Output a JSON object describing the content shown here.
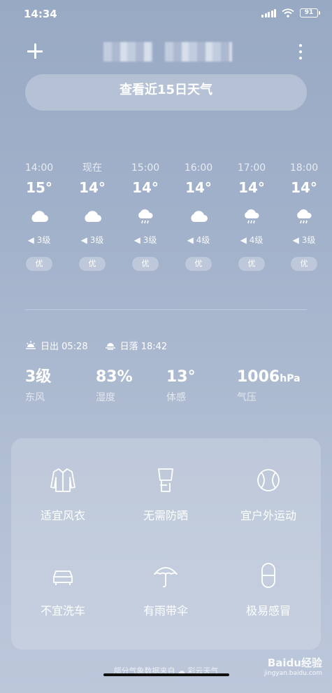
{
  "status_bar": {
    "time": "14:34",
    "battery": "91"
  },
  "header": {
    "forecast_button": "查看近15日天气"
  },
  "hourly": [
    {
      "time": "14:00",
      "temp": "15°",
      "icon": "cloudy-icon",
      "wind": "3级",
      "aqi": "优"
    },
    {
      "time": "现在",
      "temp": "14°",
      "icon": "cloudy-icon",
      "wind": "3级",
      "aqi": "优"
    },
    {
      "time": "15:00",
      "temp": "14°",
      "icon": "rain-icon",
      "wind": "3级",
      "aqi": "优"
    },
    {
      "time": "16:00",
      "temp": "14°",
      "icon": "cloudy-icon",
      "wind": "4级",
      "aqi": "优"
    },
    {
      "time": "17:00",
      "temp": "14°",
      "icon": "rain-icon",
      "wind": "4级",
      "aqi": "优"
    },
    {
      "time": "18:00",
      "temp": "14°",
      "icon": "rain-icon",
      "wind": "3级",
      "aqi": "优"
    }
  ],
  "sun": {
    "sunrise": "日出 05:28",
    "sunset": "日落 18:42"
  },
  "stats": [
    {
      "value": "3级",
      "unit": "",
      "label": "东风"
    },
    {
      "value": "83%",
      "unit": "",
      "label": "湿度"
    },
    {
      "value": "13°",
      "unit": "",
      "label": "体感"
    },
    {
      "value": "1006",
      "unit": "hPa",
      "label": "气压"
    }
  ],
  "tips": [
    {
      "label": "适宜风衣",
      "icon": "coat-icon"
    },
    {
      "label": "无需防晒",
      "icon": "sunscreen-icon"
    },
    {
      "label": "宜户外运动",
      "icon": "ball-icon"
    },
    {
      "label": "不宜洗车",
      "icon": "car-icon"
    },
    {
      "label": "有雨带伞",
      "icon": "umbrella-icon"
    },
    {
      "label": "极易感冒",
      "icon": "pill-icon"
    }
  ],
  "footer": {
    "source": "部分气象数据来自 ☁ 彩云天气"
  },
  "watermark": {
    "brand": "Baidu经验",
    "url": "jingyan.baidu.com"
  }
}
